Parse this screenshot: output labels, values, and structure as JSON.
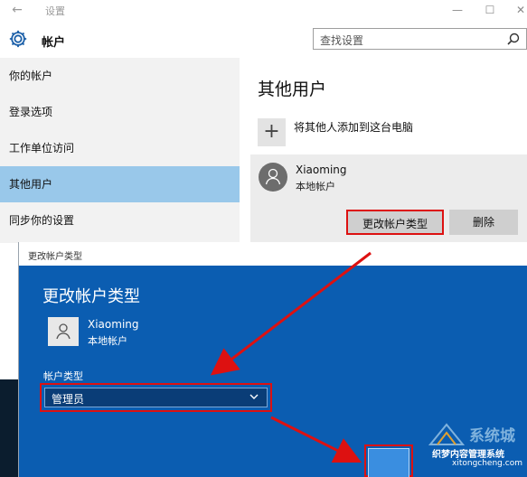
{
  "window": {
    "title": "设置",
    "back_glyph": "←",
    "minimize_glyph": "—",
    "maximize_glyph": "☐",
    "close_glyph": "✕"
  },
  "header": {
    "section_title": "帐户",
    "search_placeholder": "查找设置"
  },
  "sidebar": {
    "items": [
      {
        "label": "你的帐户"
      },
      {
        "label": "登录选项"
      },
      {
        "label": "工作单位访问"
      },
      {
        "label": "其他用户"
      },
      {
        "label": "同步你的设置"
      }
    ],
    "active_index": 3
  },
  "content": {
    "heading": "其他用户",
    "add_glyph": "+",
    "add_label": "将其他人添加到这台电脑",
    "user": {
      "name": "Xiaoming",
      "type": "本地帐户"
    },
    "change_button": "更改帐户类型",
    "delete_button": "删除"
  },
  "dialog": {
    "titlebar": "更改帐户类型",
    "heading": "更改帐户类型",
    "user_name": "Xiaoming",
    "user_type": "本地帐户",
    "field_label": "帐户类型",
    "selected_value": "管理员"
  },
  "watermark": {
    "brand": "系统城",
    "line1": "织梦内容管理系统",
    "line2": "xitongcheng.com"
  },
  "colors": {
    "accent": "#0b5db1",
    "sidebar_active": "#99c8ea",
    "highlight_red": "#dd1111"
  }
}
